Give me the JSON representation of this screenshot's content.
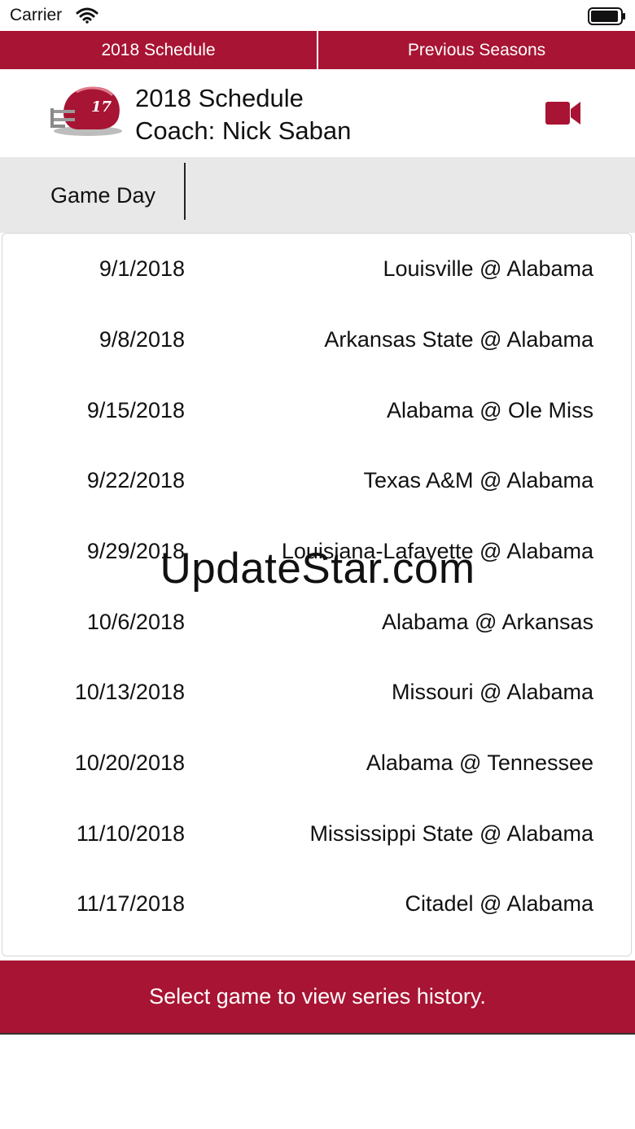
{
  "status_bar": {
    "carrier": "Carrier"
  },
  "segments": [
    "2018 Schedule",
    "Previous Seasons"
  ],
  "header": {
    "title": "2018 Schedule",
    "coach": "Coach: Nick Saban",
    "helmet_number": "17",
    "icons": {
      "helmet": "helmet-icon",
      "video": "video-camera-icon"
    }
  },
  "column_header": {
    "label": "Game Day"
  },
  "games": [
    {
      "date": "9/1/2018",
      "matchup": "Louisville @ Alabama"
    },
    {
      "date": "9/8/2018",
      "matchup": "Arkansas State @ Alabama"
    },
    {
      "date": "9/15/2018",
      "matchup": "Alabama @ Ole Miss"
    },
    {
      "date": "9/22/2018",
      "matchup": "Texas A&M @ Alabama"
    },
    {
      "date": "9/29/2018",
      "matchup": "Louisiana-Lafayette @ Alabama"
    },
    {
      "date": "10/6/2018",
      "matchup": "Alabama @ Arkansas"
    },
    {
      "date": "10/13/2018",
      "matchup": "Missouri @ Alabama"
    },
    {
      "date": "10/20/2018",
      "matchup": "Alabama @ Tennessee"
    },
    {
      "date": "11/10/2018",
      "matchup": "Mississippi State @ Alabama"
    },
    {
      "date": "11/17/2018",
      "matchup": "Citadel @ Alabama"
    }
  ],
  "watermark": "UpdateStar.com",
  "footer": {
    "text": "Select game to view series history."
  },
  "colors": {
    "accent": "#a81433",
    "header_gray": "#e8e8e8"
  }
}
